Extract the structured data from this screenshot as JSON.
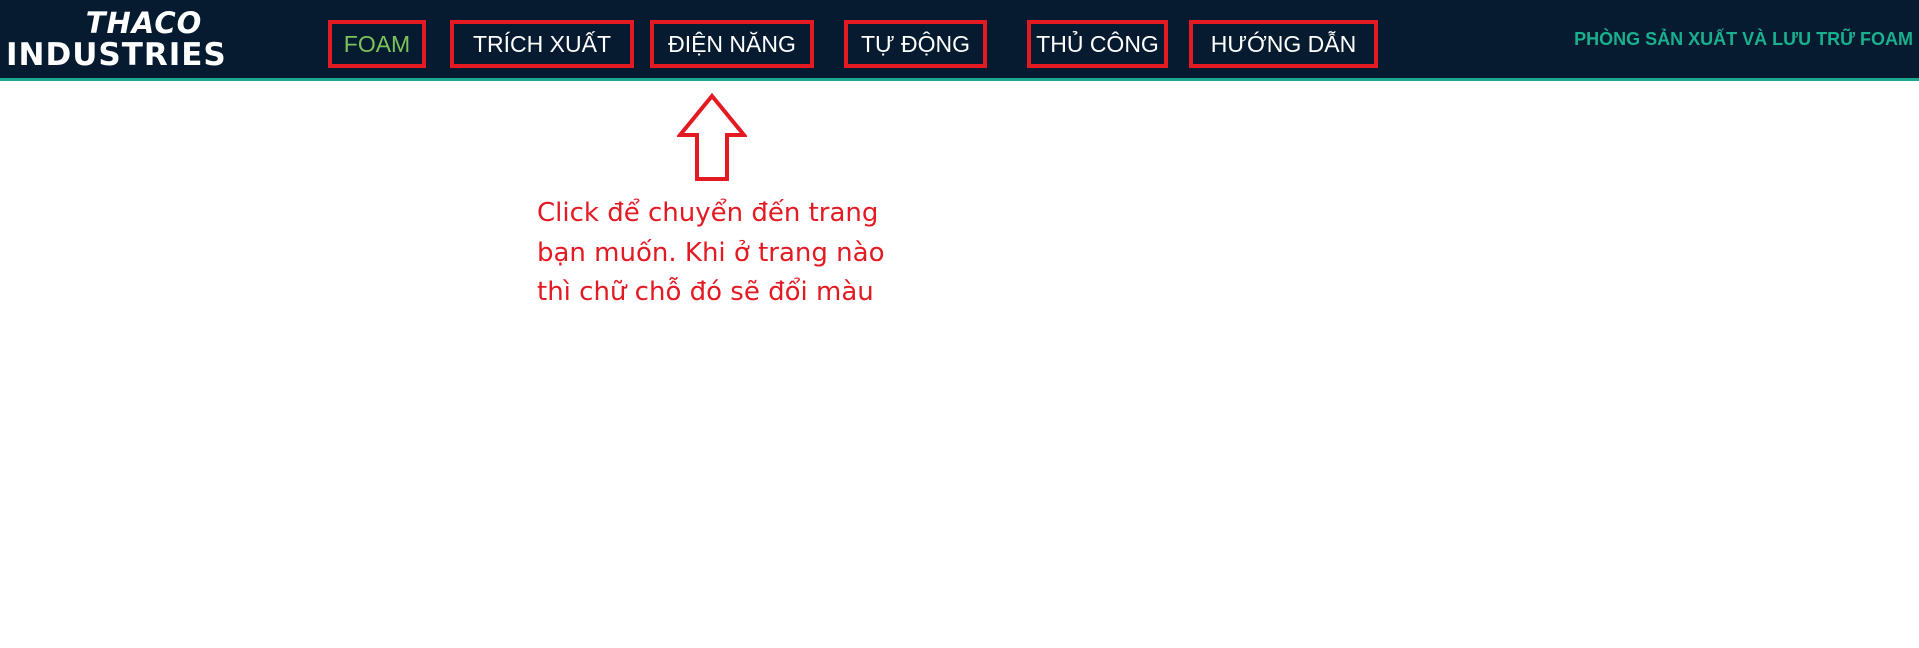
{
  "header": {
    "logo": {
      "line1": "THACO",
      "line2": "INDUSTRIES"
    },
    "nav_items": [
      {
        "label": "FOAM",
        "active": true
      },
      {
        "label": "TRÍCH XUẤT",
        "active": false
      },
      {
        "label": "ĐIỆN NĂNG",
        "active": false
      },
      {
        "label": "TỰ ĐỘNG",
        "active": false
      },
      {
        "label": "THỦ CÔNG",
        "active": false
      },
      {
        "label": "HƯỚNG DẪN",
        "active": false
      }
    ],
    "department": "PHÒNG SẢN XUẤT VÀ LƯU TRỮ FOAM"
  },
  "annotation": {
    "text": "Click để chuyển đến trang bạn muốn. Khi ở trang nào thì chữ chỗ đó sẽ đổi màu",
    "arrow_icon": "up-arrow-icon"
  },
  "colors": {
    "navbar_bg": "#061a30",
    "active_nav": "#7cc35b",
    "highlight_red": "#e41a23",
    "department_text": "#19b08d"
  }
}
